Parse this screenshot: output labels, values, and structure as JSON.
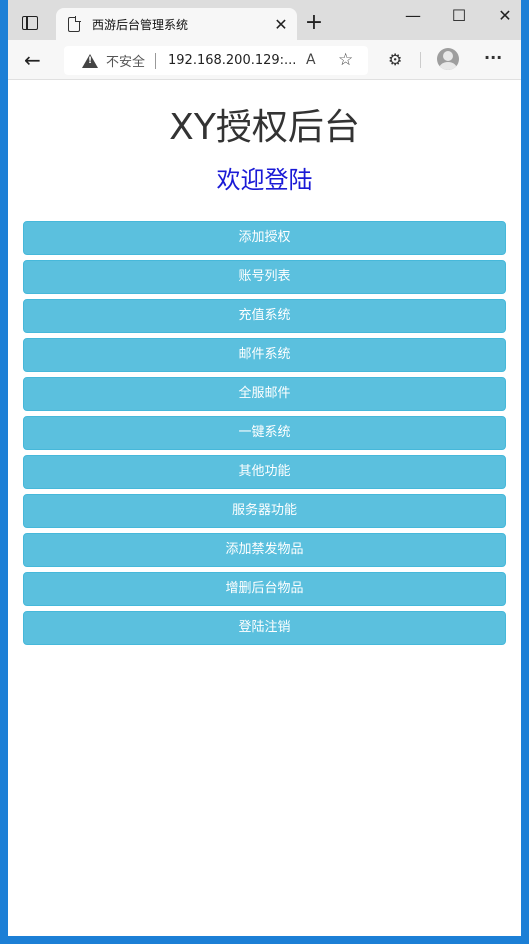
{
  "browser": {
    "tab_title": "西游后台管理系统",
    "tab_close": "✕",
    "new_tab": "+",
    "minimize": "—",
    "maximize": "☐",
    "close": "✕",
    "security_label": "不安全",
    "url": "192.168.200.129:...",
    "read_aloud": "A",
    "favorite": "☆",
    "extensions": "⚙",
    "more": "···",
    "back": "←"
  },
  "page": {
    "title": "XY授权后台",
    "subtitle": "欢迎登陆",
    "menu": [
      "添加授权",
      "账号列表",
      "充值系统",
      "邮件系统",
      "全服邮件",
      "一键系统",
      "其他功能",
      "服务器功能",
      "添加禁发物品",
      "增删后台物品",
      "登陆注销"
    ]
  },
  "colors": {
    "button_bg": "#5bc0de",
    "subtitle": "#1a1ad6",
    "desktop": "#1c7fd6"
  }
}
